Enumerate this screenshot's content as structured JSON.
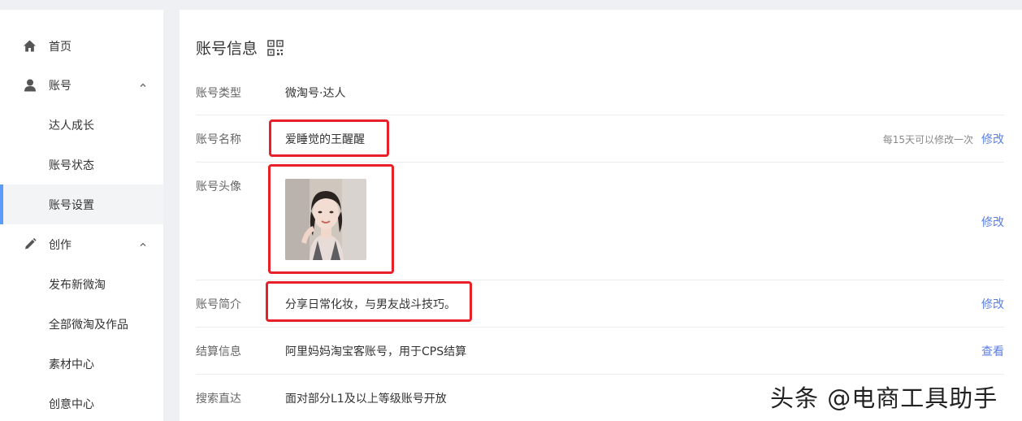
{
  "sidebar": {
    "items": [
      {
        "label": "首页",
        "icon": "home-icon"
      },
      {
        "label": "账号",
        "icon": "user-icon",
        "expanded": true
      },
      {
        "label": "达人成长"
      },
      {
        "label": "账号状态"
      },
      {
        "label": "账号设置",
        "active": true
      },
      {
        "label": "创作",
        "icon": "pencil-icon",
        "expanded": true
      },
      {
        "label": "发布新微淘"
      },
      {
        "label": "全部微淘及作品"
      },
      {
        "label": "素材中心"
      },
      {
        "label": "创意中心"
      }
    ]
  },
  "main": {
    "title": "账号信息",
    "rows": [
      {
        "label": "账号类型",
        "value": "微淘号·达人"
      },
      {
        "label": "账号名称",
        "value": "爱睡觉的王醒醒",
        "hint": "每15天可以修改一次",
        "action": "修改"
      },
      {
        "label": "账号头像",
        "action": "修改"
      },
      {
        "label": "账号简介",
        "value": "分享日常化妆，与男友战斗技巧。",
        "action": "修改"
      },
      {
        "label": "结算信息",
        "value": "阿里妈妈淘宝客账号，用于CPS结算",
        "action": "查看"
      },
      {
        "label": "搜索直达",
        "value": "面对部分L1及以上等级账号开放"
      }
    ]
  },
  "watermark": "头条 @电商工具助手",
  "colors": {
    "link": "#5b7ee5",
    "highlight_box": "#e8202a",
    "active_bar": "#5a9cf8"
  }
}
